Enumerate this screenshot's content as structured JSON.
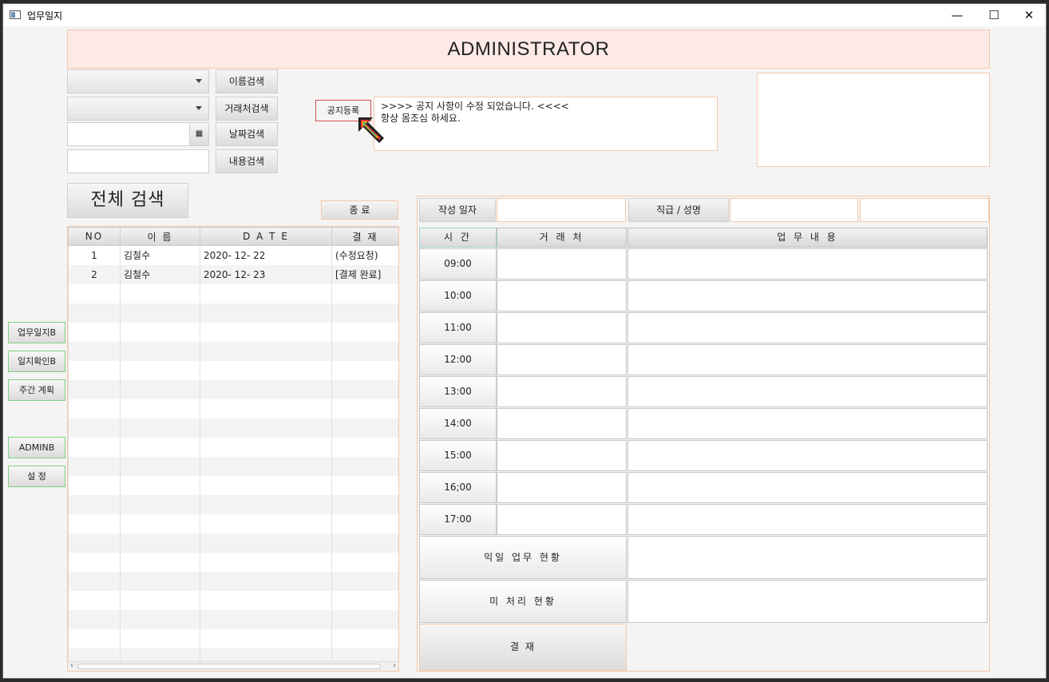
{
  "window": {
    "title": "업무일지",
    "minimize": "—",
    "maximize": "☐",
    "close": "✕"
  },
  "header": {
    "title": "ADMINISTRATOR"
  },
  "search": {
    "name_search": "이름검색",
    "client_search": "거래처검색",
    "date_search": "날짜검색",
    "content_search": "내용검색",
    "all_search": "전체 검색",
    "exit": "종  료"
  },
  "notice": {
    "register": "공지등록",
    "line1": ">>>> 공지 사항이 수정 되었습니다. <<<<",
    "line2": "항상 몸조심 하세요."
  },
  "sidebar": {
    "items": [
      {
        "label": "업무일지B"
      },
      {
        "label": "일지확인B"
      },
      {
        "label": "주간 계획"
      },
      {
        "label": "ADMINB"
      },
      {
        "label": "설  정"
      }
    ]
  },
  "list": {
    "headers": [
      "NO",
      "이  름",
      "D A T E",
      "결 재"
    ],
    "rows": [
      {
        "no": "1",
        "name": "김철수",
        "date": "2020- 12- 22",
        "status": "(수정요청)"
      },
      {
        "no": "2",
        "name": "김철수",
        "date": "2020- 12- 23",
        "status": "[결제 완료]"
      }
    ]
  },
  "form": {
    "date_label": "작성 일자",
    "rank_label": "직급 / 성명",
    "col_time": "시  간",
    "col_client": "거 래 처",
    "col_content": "업       무       내       용",
    "times": [
      "09:00",
      "10:00",
      "11:00",
      "12:00",
      "13:00",
      "14:00",
      "15:00",
      "16;00",
      "17:00"
    ],
    "next_day": "익일  업무  현황",
    "pending": "미  처리    현황",
    "approve": "결 재"
  },
  "colors": {
    "accent_border": "#f5c8a8",
    "banner_bg": "#fdeae6",
    "side_border": "#7fd27f",
    "notice_border": "#d9534f"
  }
}
